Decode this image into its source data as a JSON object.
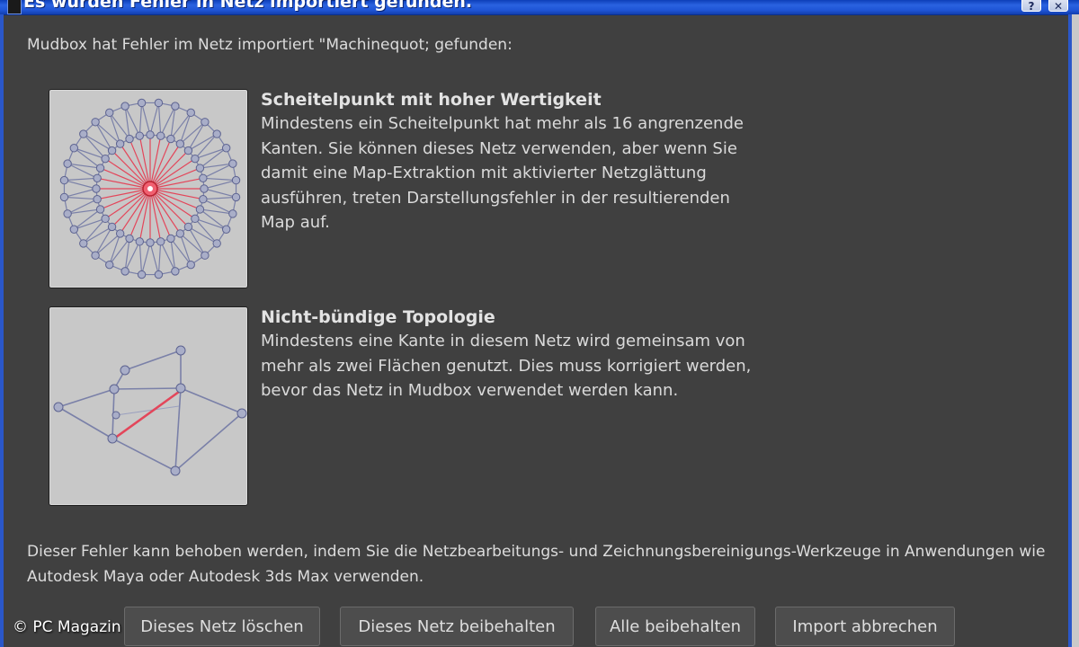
{
  "window": {
    "title": "Es wurden Fehler in Netz importiert  gefunden.",
    "help_icon": "?",
    "close_icon": "✕"
  },
  "intro_text": "Mudbox hat Fehler im Netz importiert  \"Machinequot; gefunden:",
  "issues": [
    {
      "title": "Scheitelpunkt mit hoher Wertigkeit",
      "body": "Mindestens ein Scheitelpunkt hat mehr als 16 angrenzende Kanten. Sie können dieses Netz verwenden, aber wenn Sie damit eine Map-Extraktion mit aktivierter Netzglättung ausführen, treten Darstellungsfehler in der resultierenden Map auf.",
      "thumbnail_icon": "high-valence-vertex-icon"
    },
    {
      "title": "Nicht-bündige Topologie",
      "body": "Mindestens eine Kante in diesem Netz wird gemeinsam von mehr als zwei Flächen genutzt. Dies muss korrigiert werden, bevor das Netz in Mudbox verwendet werden kann.",
      "thumbnail_icon": "non-manifold-topology-icon"
    }
  ],
  "footer_text": "Dieser Fehler kann behoben werden, indem Sie die Netzbearbeitungs- und Zeichnungsbereinigungs-Werkzeuge in Anwendungen wie Autodesk Maya oder Autodesk 3ds Max verwenden.",
  "buttons": {
    "delete": "Dieses Netz löschen",
    "keep": "Dieses Netz beibehalten",
    "keep_all": "Alle beibehalten",
    "abort": "Import abbrechen"
  },
  "copyright": "© PC Magazin",
  "colors": {
    "background": "#404040",
    "title_bar": "#1f55d6",
    "highlight_edge": "#e3465a",
    "mesh_edge": "#7a80a8",
    "mesh_vertex": "#a9aec8"
  }
}
